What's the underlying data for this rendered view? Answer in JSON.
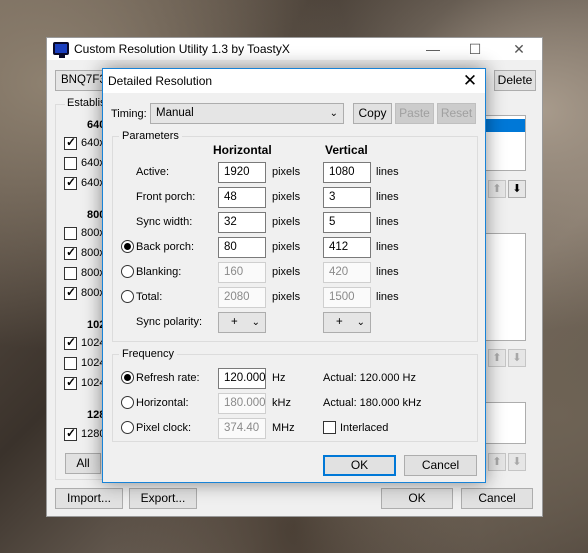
{
  "main_window": {
    "title": "Custom Resolution Utility 1.3 by ToastyX",
    "controls": {
      "minimize": "—",
      "maximize": "☐",
      "close": "✕"
    },
    "monitor_select": "BNQ7F3D",
    "delete_label": "Delete",
    "established_label": "Establis",
    "groups": [
      {
        "heading": "640",
        "items": [
          {
            "label": "640x",
            "checked": true
          },
          {
            "label": "640x",
            "checked": false
          },
          {
            "label": "640x",
            "checked": true
          }
        ]
      },
      {
        "heading": "800",
        "items": [
          {
            "label": "800x",
            "checked": false
          },
          {
            "label": "800x",
            "checked": true
          },
          {
            "label": "800x",
            "checked": false
          },
          {
            "label": "800x",
            "checked": true
          }
        ]
      },
      {
        "heading": "102",
        "items": [
          {
            "label": "1024",
            "checked": true
          },
          {
            "label": "1024",
            "checked": false
          },
          {
            "label": "1024",
            "checked": true
          }
        ]
      },
      {
        "heading": "128",
        "items": [
          {
            "label": "1280",
            "checked": true
          }
        ]
      }
    ],
    "all_label": "All",
    "import_label": "Import...",
    "export_label": "Export...",
    "ok_label": "OK",
    "cancel_label": "Cancel"
  },
  "dialog": {
    "title": "Detailed Resolution",
    "close": "✕",
    "timing_label": "Timing:",
    "timing_value": "Manual",
    "copy_label": "Copy",
    "paste_label": "Paste",
    "reset_label": "Reset",
    "parameters_title": "Parameters",
    "horizontal_header": "Horizontal",
    "vertical_header": "Vertical",
    "rows": [
      {
        "label": "Active:",
        "h": "1920",
        "h_unit": "pixels",
        "v": "1080",
        "v_unit": "lines"
      },
      {
        "label": "Front porch:",
        "h": "48",
        "h_unit": "pixels",
        "v": "3",
        "v_unit": "lines"
      },
      {
        "label": "Sync width:",
        "h": "32",
        "h_unit": "pixels",
        "v": "5",
        "v_unit": "lines"
      },
      {
        "label": "Back porch:",
        "h": "80",
        "h_unit": "pixels",
        "v": "412",
        "v_unit": "lines"
      },
      {
        "label": "Blanking:",
        "h": "160",
        "h_unit": "pixels",
        "v": "420",
        "v_unit": "lines"
      },
      {
        "label": "Total:",
        "h": "2080",
        "h_unit": "pixels",
        "v": "1500",
        "v_unit": "lines"
      }
    ],
    "sync_polarity_label": "Sync polarity:",
    "h_polarity": "+",
    "v_polarity": "+",
    "frequency_title": "Frequency",
    "refresh_label": "Refresh rate:",
    "refresh_value": "120.000",
    "refresh_unit": "Hz",
    "refresh_actual": "Actual: 120.000 Hz",
    "horizontal_label": "Horizontal:",
    "horizontal_value": "180.000",
    "horizontal_unit": "kHz",
    "horizontal_actual": "Actual: 180.000 kHz",
    "pixel_clock_label": "Pixel clock:",
    "pixel_clock_value": "374.40",
    "pixel_clock_unit": "MHz",
    "interlaced_label": "Interlaced",
    "ok_label": "OK",
    "cancel_label": "Cancel"
  }
}
